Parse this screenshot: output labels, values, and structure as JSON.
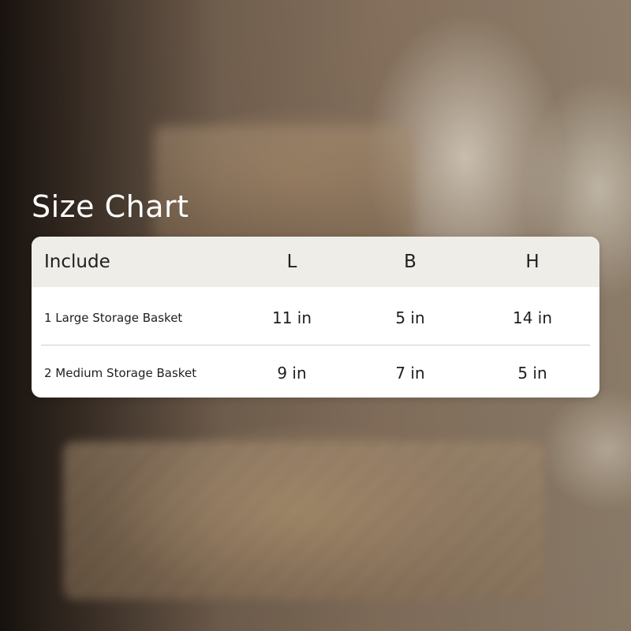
{
  "title": "Size Chart",
  "table": {
    "headers": [
      "Include",
      "L",
      "B",
      "H"
    ],
    "rows": [
      [
        "1 Large Storage Basket",
        "11 in",
        "5 in",
        "14 in"
      ],
      [
        "2 Medium Storage Basket",
        "9 in",
        "7 in",
        "5 in"
      ]
    ]
  }
}
